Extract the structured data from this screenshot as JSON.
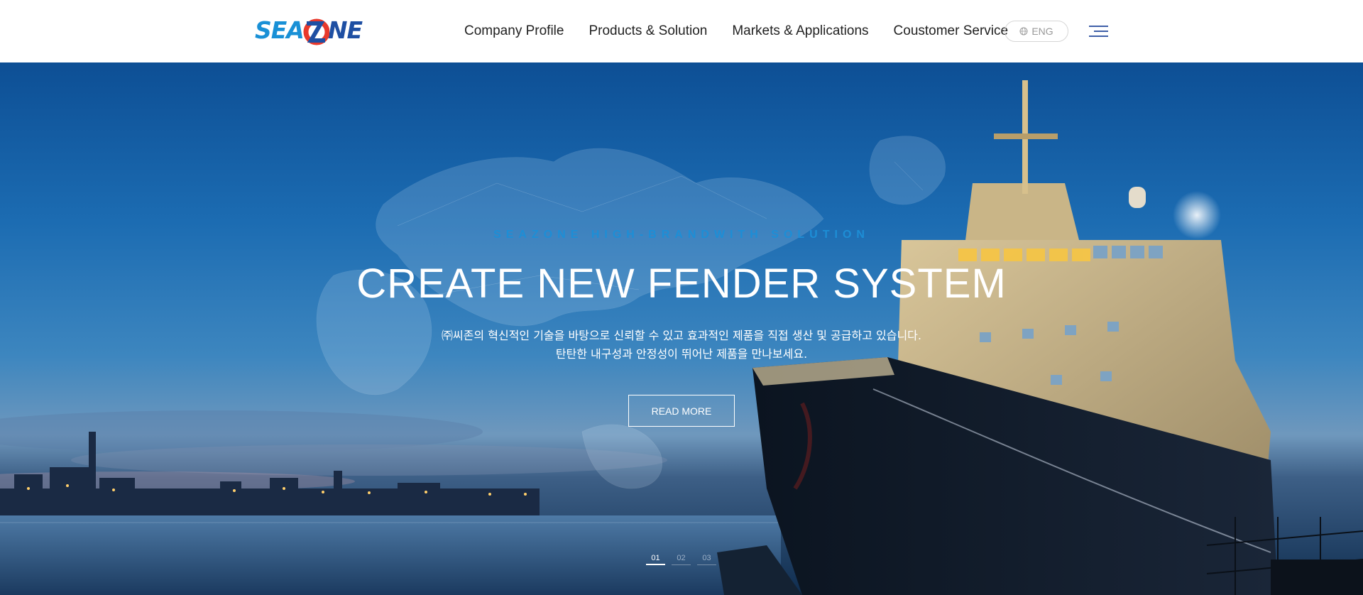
{
  "brand": {
    "logo_text_left": "SEA",
    "logo_text_right": "NE",
    "logo_alt": "SEAZONE"
  },
  "nav": {
    "items": [
      {
        "label": "Company Profile"
      },
      {
        "label": "Products & Solution"
      },
      {
        "label": "Markets & Applications"
      },
      {
        "label": "Coustomer Service"
      }
    ],
    "language_label": "ENG"
  },
  "hero": {
    "kicker": "SEAZONE HIGH-BRANDWITH SOLUTION",
    "title": "CREATE NEW FENDER SYSTEM",
    "description_line1": "㈜씨존의 혁신적인 기술을 바탕으로 신뢰할 수 있고 효과적인 제품을 직접 생산 및 공급하고 있습니다.",
    "description_line2": "탄탄한 내구성과 안정성이 뛰어난 제품을 만나보세요.",
    "button_label": "READ MORE"
  },
  "slider": {
    "pages": [
      "01",
      "02",
      "03"
    ],
    "active_page": "01"
  },
  "colors": {
    "accent": "#1d8ed6",
    "logo_dark": "#1e4fa3",
    "logo_red": "#e8392c",
    "menu_icon": "#3f5fa8"
  },
  "icons": {
    "language": "globe-icon",
    "menu": "hamburger-menu-icon"
  }
}
